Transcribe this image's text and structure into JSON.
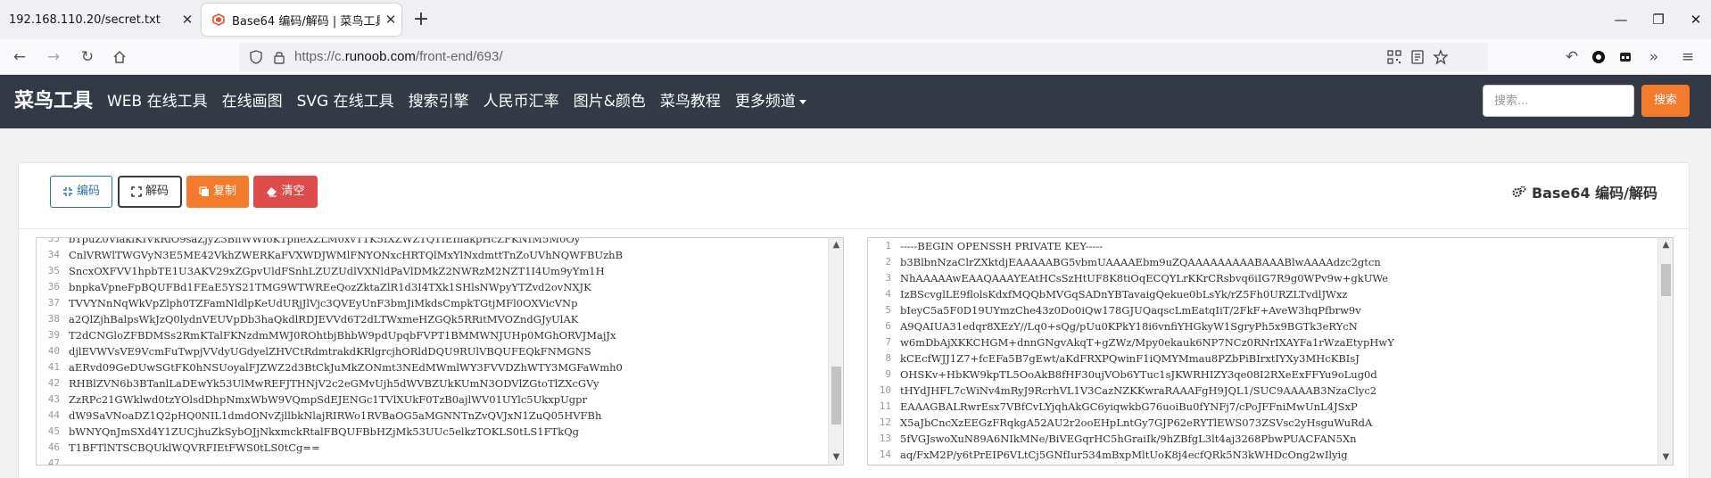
{
  "browser": {
    "tabs": [
      {
        "label": "192.168.110.20/secret.txt"
      },
      {
        "label": "Base64 编码/解码 | 菜鸟工具"
      }
    ],
    "url_prefix": "https://c.",
    "url_host": "runoob.com",
    "url_path": "/front-end/693/"
  },
  "site": {
    "logo": "菜鸟工具",
    "nav": [
      "WEB 在线工具",
      "在线画图",
      "SVG 在线工具",
      "搜索引擎",
      "人民币汇率",
      "图片&颜色",
      "菜鸟教程",
      "更多频道"
    ],
    "search_placeholder": "搜索...",
    "search_button": "搜索",
    "accent": "#f57b2c",
    "header_bg": "#333a45"
  },
  "tool": {
    "title": "Base64 编码/解码",
    "encode_label": "编码",
    "decode_label": "解码",
    "copy_label": "复制",
    "clear_label": "清空"
  },
  "input_editor": {
    "line_numbers": [
      "33",
      "34",
      "35",
      "36",
      "37",
      "38",
      "39",
      "40",
      "41",
      "42",
      "43",
      "44",
      "45",
      "46",
      "47"
    ],
    "lines": [
      "b1puZ0ViaklKIVkRlO9saZjyZ3BnWWIoK1pneXZLM0xvT1K5IXZWZ1Q1IEInakpHcZFKNIM5M0Oy",
      "CnlVRWlTWGVyN3E5ME42VkhZWERKaFVXWDJWMlFNYONxcHRTQlMxYlNxdmttTnZoUVhNQWFBUzhB",
      "SncxOXFVV1hpbTE1U3AKV29xZGpvUldFSnhLZUZUdlVXNldPaVlDMkZ2NWRzM2NZT1I4Um9yYm1H",
      "bnpkaVpneFpBQUFBd1FEaE5YS21TMG9WTWREeQozZktaZlR1d3I4TXk1SHlsNWpyYTZvd2ovNXJK",
      "TVVYNnNqWkVpZlph0TZFamNldlpKeUdURjJlVjc3QVEyUnF3bmJiMkdsCmpkTGtjMFl0OXVicVNp",
      "a2QlZjhBalpsWkJzQ0lydnVEUVpDb3haQkdlRDJEVVd6T2dLTWxmeHZGQk5RRitMVOZndGJyUlAK",
      "T2dCNGloZFBDMSs2RmKTalFKNzdmMWJ0ROhtbjBhbW9pdUpqbFVPT1BMMWNJUHp0MGhORVJMajJx",
      "djlEVWVsVE9VcmFuTwpjVVdyUGdyelZHVCtRdmtrakdKRlgrcjhORldDQU9RUlVBQUFEQkFNMGNS",
      "aERvd09GeDUwSGtFK0hNSUoyalFJZWZ2d3BtCkJuMkZONmt3NEdMWmlWY3FVVDZhWTY3MGFaWmh0",
      "RHBlZVN6b3BTanlLaDEwYk53UlMwREFJTHNjV2c2eGMvUjh5dWVBZUkKUmN3ODVlZGtoTlZXcGVy",
      "ZzRPc21GWklwd0tzYOlsdDhpNmxWbW9VQmpSdEJENGc1TVlXUkF0TzB0ajlWV01UYlc5UkxpUgpr",
      "dW9SaVNoaDZ1Q2pHQ0NIL1dmdONvZjllbkNlajRIRWo1RVBaOG5aMGNNTnZvQVJxN1ZuQ05HVFBh",
      "bWNYQnJmSXd4Y1ZUCjhuZkSybOJjNkxmckRtalFBQUFBbHZjMk53UUc5elkzTOKLS0tLS1FTkQg",
      "T1BFTlNTSCBQUklWQVRFIEtFWS0tLS0tCg=="
    ],
    "scroll_thumb_top": 0.57,
    "scroll_thumb_size": 0.29
  },
  "output_editor": {
    "line_numbers": [
      "1",
      "2",
      "3",
      "4",
      "5",
      "6",
      "7",
      "8",
      "9",
      "10",
      "11",
      "12",
      "13",
      "14",
      "15"
    ],
    "lines": [
      "-----BEGIN OPENSSH PRIVATE KEY-----",
      "b3BlbnNzaClrZXktdjEAAAAABG5vbmUAAAAEbm9uZQAAAAAAAAABAAABlwAAAAdzc2gtcn",
      "NhAAAAAwEAAQAAAYEAtHCsSzHtUF8K8tiOqECQYLrKKrCRsbvq6iIG7R9g0WPv9w+gkUWe",
      "IzBScvglLE9flolsKdxfMQQbMVGqSADnYBTavaigQekue0bLsYk/rZ5Fh0URZLTvdlJWxz",
      "bIeyC5a5F0D19UYmzChe43z0Do0iQw178GJUQaqscLmEatqIiT/2FkF+AveW3hqPfbrw9v",
      "A9QAIUA31edqr8XEzY//Lq0+sQg/pUu0KPkY18i6vnfiYHGkyW1SgryPh5x9BGTk3eRYcN",
      "w6mDbAjXKKCHGM+dnnGNgvAkqT+gZWz/Mpy0ekauk6NP7NCz0RNrIXAYFa1rWzaEtypHwY",
      "kCEcfWJJ1Z7+fcEFa5B7gEwt/aKdFRXPQwinF1iQMYMmau8PZbPiBIrxtIYXy3MHcKBIsJ",
      "OHSKv+HbKW9kpTL5OoAkB8fHF30ujVOb6YTuc1sJKWRHIZY3qe08I2RXeExFFYu9oLug0d",
      "tHYdJHFL7cWiNv4mRyJ9RcrhVL1V3CazNZKKwraRAAAFgH9JQL1/SUC9AAAAB3NzaClyc2",
      "EAAAGBALRwrEsx7VBfCvLYjqhAkGC6yiqwkbG76uoiBu0fYNFj7/cPoJFFniMwUnL4JSxP",
      "X5aJbCncXzEEGzFRqkgA52AU2r2ooEHpLntGy7GJP62eRYTlEWS073ZSVsc2yHsguWuRdA",
      "5fVGJswoXuN89A6NIkMNe/BiVEGqrHC5hGraiIk/9hZBfgL3lt4aj3268PbwPUACFAN5Xn",
      "aq/FxM2P/y6tPrEIP6VLtCj5GNfIur534mBxpMltUoK8j4ecfQRk5N3kWHDcOng2wIlyig",
      ""
    ],
    "scroll_thumb_top": 0.06,
    "scroll_thumb_size": 0.16
  }
}
